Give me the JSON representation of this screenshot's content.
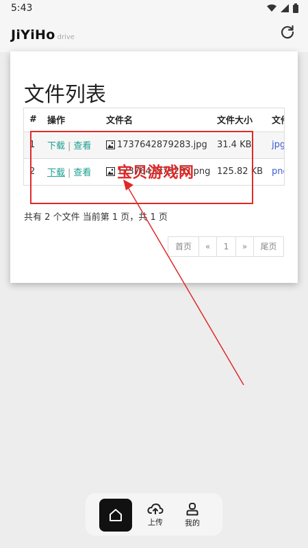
{
  "status": {
    "time": "5:43"
  },
  "app": {
    "name": "JiYiHo",
    "sub": "drive"
  },
  "page": {
    "title": "文件列表"
  },
  "table": {
    "headers": [
      "#",
      "操作",
      "文件名",
      "文件大小",
      "文件"
    ],
    "rows": [
      {
        "idx": "1",
        "download": "下载",
        "view": "查看",
        "name": "1737642879283.jpg",
        "size": "31.4 KB",
        "ext": "jpg"
      },
      {
        "idx": "2",
        "download": "下载",
        "view": "查看",
        "name": "1737642879283.png",
        "size": "125.82 KB",
        "ext": "png"
      }
    ]
  },
  "summary": {
    "part1": "共有",
    "files": "2",
    "part2": "个文件  当前第",
    "page": "1",
    "part3": "页，共",
    "pages": "1",
    "part4": "页"
  },
  "pager": {
    "first": "首页",
    "prev": "«",
    "current": "1",
    "next": "»",
    "last": "尾页"
  },
  "watermark": "宝贝游戏网",
  "nav": {
    "upload": "上传",
    "mine": "我的"
  },
  "colors": {
    "accent": "#1a9e8f",
    "ext_link": "#3a5ad6",
    "annotation": "#e12828"
  }
}
